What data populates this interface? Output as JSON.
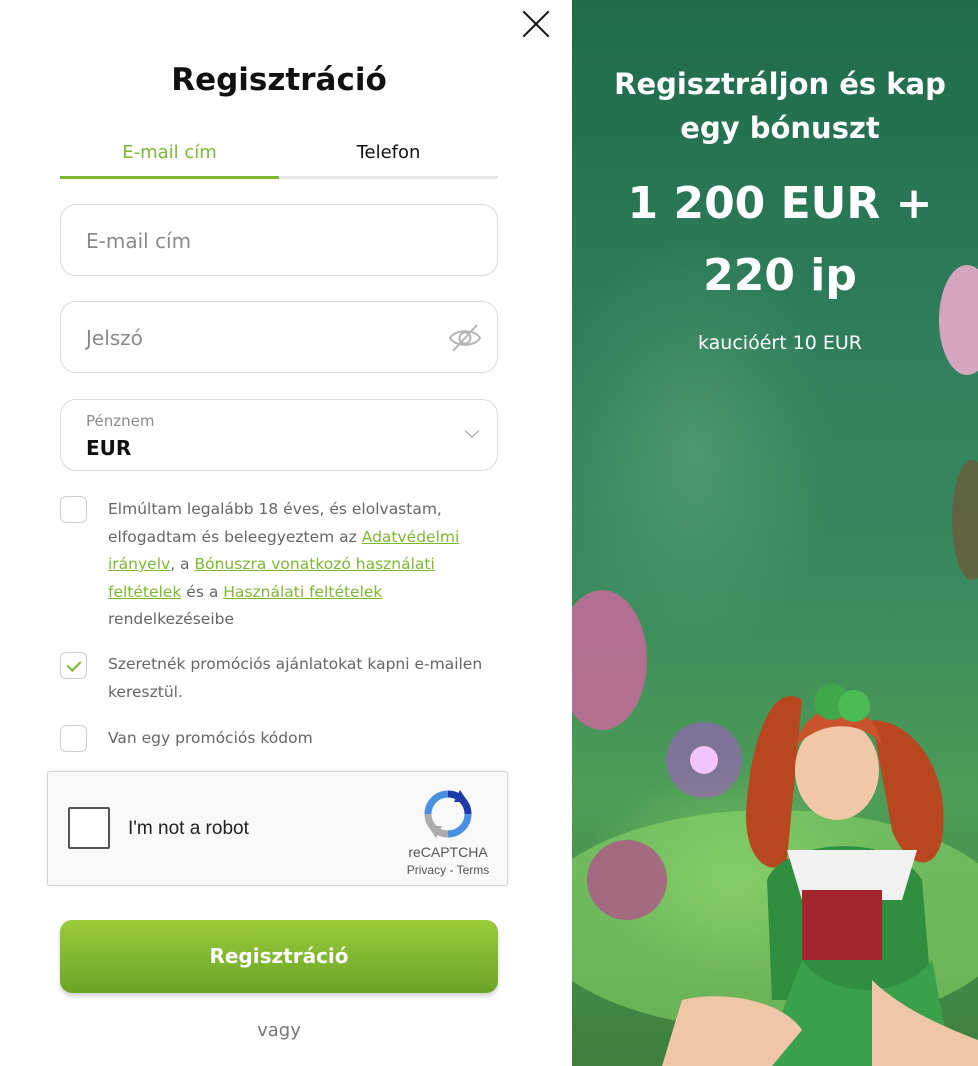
{
  "form": {
    "title": "Regisztráció",
    "tabs": [
      {
        "label": "E-mail cím",
        "active": true
      },
      {
        "label": "Telefon",
        "active": false
      }
    ],
    "email_placeholder": "E-mail cím",
    "password_placeholder": "Jelszó",
    "currency_label": "Pénznem",
    "currency_value": "EUR",
    "consent": {
      "text_1": "Elmúltam legalább 18 éves, és elolvastam, elfogadtam és beleegyeztem az ",
      "link_1": "Adatvédelmi irányelv",
      "text_2": ", a ",
      "link_2": "Bónuszra vonatkozó használati feltételek",
      "text_3": " és a ",
      "link_3": "Használati feltételek",
      "text_4": " rendelkezéseibe",
      "checked": false
    },
    "promo_emails": {
      "label": "Szeretnék promóciós ajánlatokat kapni e-mailen keresztül.",
      "checked": true
    },
    "promo_code": {
      "label": "Van egy promóciós kódom",
      "checked": false
    },
    "captcha": {
      "label": "I'm not a robot",
      "brand": "reCAPTCHA",
      "privacy": "Privacy",
      "separator": " - ",
      "terms": "Terms"
    },
    "submit_label": "Regisztráció",
    "or_label": "vagy"
  },
  "promo": {
    "headline_line1": "Regisztráljon és kap",
    "headline_line2": "egy bónuszt",
    "bonus_line1": "1 200 EUR +",
    "bonus_line2": "220 ip",
    "deposit": "kaucióért 10 EUR"
  },
  "colors": {
    "accent": "#7cb82f",
    "button_top": "#9bcc3c",
    "button_bottom": "#6aa426",
    "promo_bg": "#2e7d5a"
  },
  "icons": {
    "close": "close-icon",
    "password_toggle": "eye-off-icon",
    "dropdown": "chevron-down-icon",
    "captcha": "recaptcha-icon"
  }
}
